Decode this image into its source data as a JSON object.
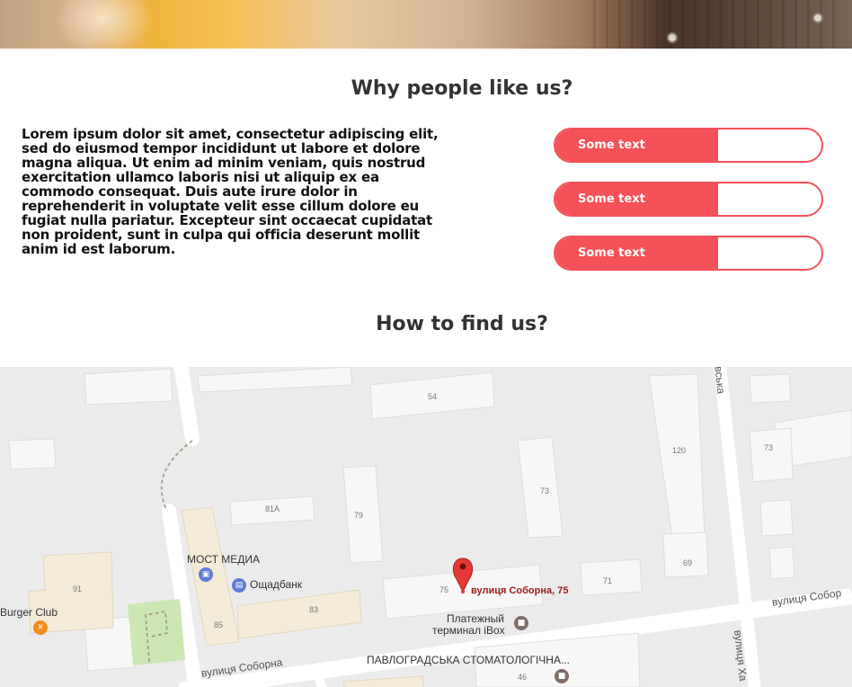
{
  "sections": {
    "why_title": "Why people like us?",
    "why_text": "Lorem ipsum dolor sit amet, consectetur adipiscing elit, sed do eiusmod tempor incididunt ut labore et dolore magna aliqua. Ut enim ad minim veniam, quis nostrud exercitation ullamco laboris nisi ut aliquip ex ea commodo consequat. Duis aute irure dolor in reprehenderit in voluptate velit esse cillum dolore eu fugiat nulla pariatur. Excepteur sint occaecat cupidatat non proident, sunt in culpa qui officia deserunt mollit anim id est laborum.",
    "how_title": "How to find us?"
  },
  "bars": [
    {
      "label": "Some text",
      "level": 0.61
    },
    {
      "label": "Some text",
      "level": 0.61
    },
    {
      "label": "Some text",
      "level": 0.61
    }
  ],
  "colors": {
    "accent": "#f45158",
    "heading": "#333333",
    "text": "#111111",
    "map_bg": "#ebebeb",
    "marker": "#e53935",
    "address": "#9c1b1b"
  },
  "map": {
    "marker_address": "вулиця Соборна, 75",
    "places": {
      "most_media": "МОСТ МЕДИА",
      "oshchadbank": "Ощадбанк",
      "burger_club": "Burger Club",
      "platezhny_1": "Платежный",
      "platezhny_2": "терминал iBox",
      "stomatology": "ПАВЛОГРАДСЬКА СТОМАТОЛОГІЧНА..."
    },
    "streets": {
      "soborna_bottom": "вулиця Соборна",
      "soborna_right": "вулиця Собор",
      "kha_vertical": "вулиця Ха",
      "top_vertical": "івська"
    },
    "building_numbers": [
      "54",
      "120",
      "73",
      "73",
      "81A",
      "79",
      "69",
      "71",
      "91",
      "85",
      "83",
      "75",
      "46"
    ],
    "icons": [
      "map-pin-icon",
      "shopping-bag-icon",
      "bank-icon",
      "restaurant-icon",
      "store-icon"
    ]
  }
}
